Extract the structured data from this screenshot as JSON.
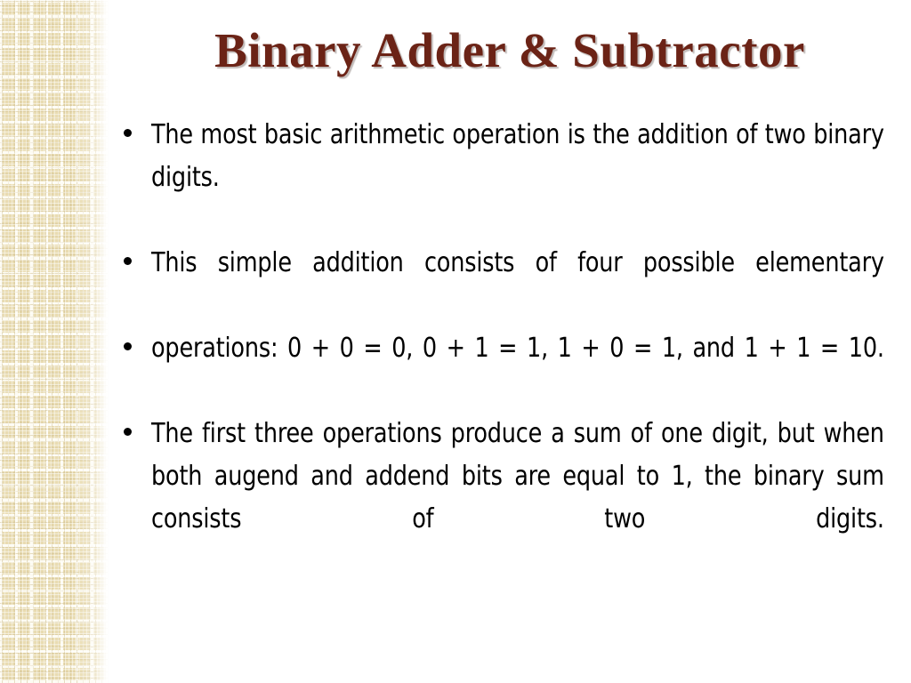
{
  "slide": {
    "title": "Binary Adder & Subtractor",
    "title_color": "#6b2316",
    "background_color": "#ffffff",
    "sidebar": {
      "name": "textured-grid-band",
      "tile_color": "#e9dcb2",
      "gridline_color": "#fdfbf2"
    },
    "bullets": [
      {
        "marker": "bullet-dot",
        "text": "The most basic arithmetic operation is the addition of two binary digits."
      },
      {
        "marker": "bullet-dot",
        "text": "This simple addition consists of four possible elementary"
      },
      {
        "marker": "bullet-dot",
        "text": "operations: 0 + 0 = 0, 0 + 1 = 1, 1 + 0 = 1, and 1 + 1 = 10."
      },
      {
        "marker": "bullet-dot",
        "text": "The first three operations produce a sum of one digit, but when both augend and addend bits are equal to 1, the binary sum consists of two digits."
      }
    ]
  }
}
